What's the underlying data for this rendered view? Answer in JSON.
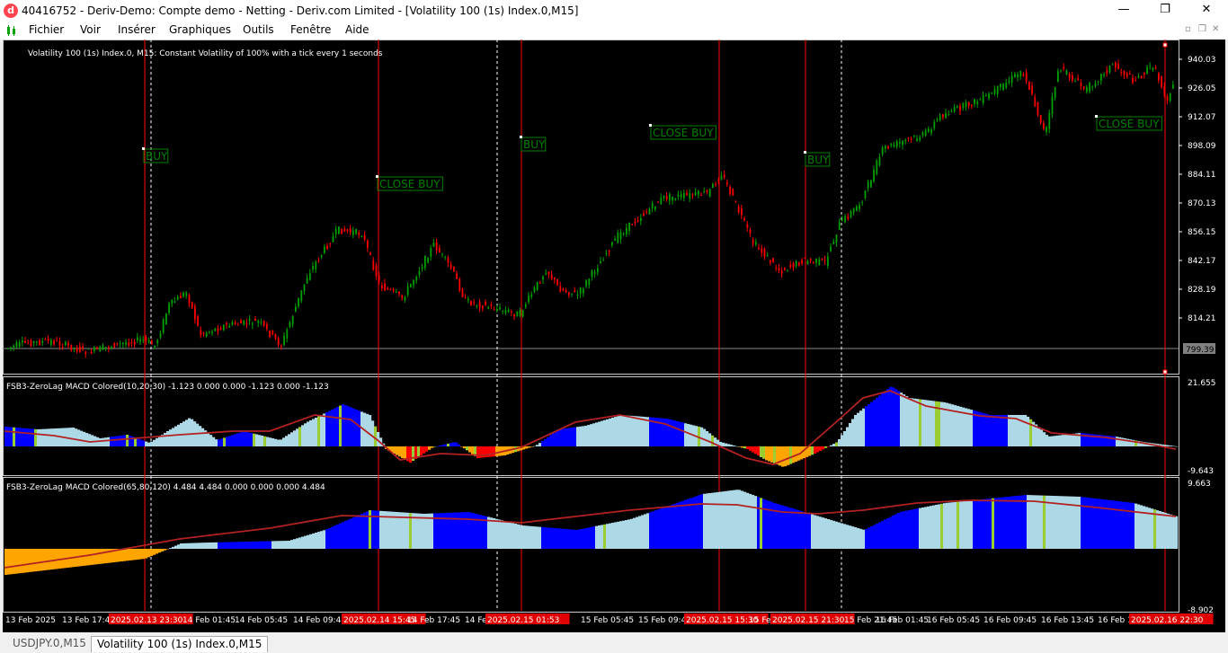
{
  "window": {
    "title": "40416752 - Deriv-Demo: Compte demo - Netting - Deriv.com Limited - [Volatility 100 (1s) Index.0,M15]",
    "app_icon_letter": "d",
    "minimize": "—",
    "maximize": "❐",
    "close": "✕"
  },
  "menu": {
    "items": [
      "Fichier",
      "Voir",
      "Insérer",
      "Graphiques",
      "Outils",
      "Fenêtre",
      "Aide"
    ]
  },
  "chart": {
    "description": "Volatility 100 (1s) Index.0, M15:  Constant Volatility of 100% with a tick every 1 seconds",
    "price_labels": [
      "940.03",
      "926.05",
      "912.07",
      "898.09",
      "884.11",
      "870.13",
      "856.15",
      "842.17",
      "828.19",
      "814.21"
    ],
    "current_price": "799.39",
    "colors": {
      "up_candle": "#00a000",
      "down_candle": "#ff0000",
      "vline": "#ff0000",
      "trade_label": "#008000",
      "macd_blue": "#0000ff",
      "macd_light": "#add8e6",
      "macd_orange": "#ffa500",
      "macd_yellow": "#9acd32",
      "signal": "#b22222"
    },
    "trade_labels": [
      {
        "text": "BUY"
      },
      {
        "text": "CLOSE BUY"
      },
      {
        "text": "BUY"
      },
      {
        "text": "CLOSE BUY"
      },
      {
        "text": "BUY"
      },
      {
        "text": "CLOSE BUY"
      }
    ],
    "indicator1": {
      "label": "FSB3-ZeroLag MACD Colored(10,20,30) -1.123 0.000 0.000 -1.123 0.000 -1.123",
      "max_label": "21.655",
      "min_label": "-9.643"
    },
    "indicator2": {
      "label": "FSB3-ZeroLag MACD Colored(65,80,120) 4.484 4.484 0.000 0.000 0.000 4.484",
      "max_label": "9.663",
      "min_label": "-8.902"
    },
    "time_labels": [
      "13 Feb 2025",
      "13 Feb 17:45",
      "2025.02.13 23:30",
      "14 Feb 01:45",
      "14 Feb 05:45",
      "14 Feb 09:45",
      "2025.02.14 15:45",
      "14 Feb 17:45",
      "14 Feb 21:45",
      "2025.02.15 01:53",
      "15 Feb 05:45",
      "15 Feb 09:45",
      "2025.02.15 15:30",
      "15 Feb 17:45",
      "2025.02.15 21:30",
      "15 Feb 21:45",
      "16 Feb 01:45",
      "16 Feb 05:45",
      "16 Feb 09:45",
      "16 Feb 13:45",
      "16 Feb 17:45",
      "2025.02.16 22:30"
    ]
  },
  "tabs": [
    {
      "label": "USDJPY.0,M15"
    },
    {
      "label": "Volatility 100 (1s) Index.0,M15"
    }
  ]
}
